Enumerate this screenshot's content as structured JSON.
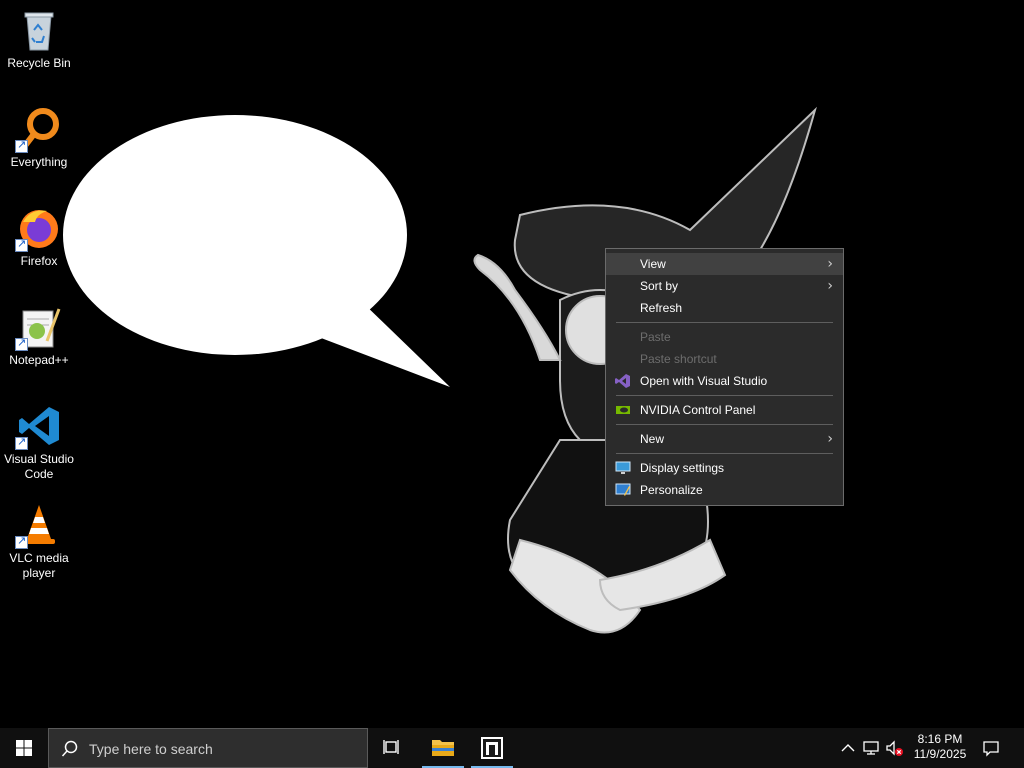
{
  "desktop": {
    "icons": [
      {
        "label": "Recycle Bin",
        "icon": "recycle-bin-icon",
        "shortcut": false
      },
      {
        "label": "Everything",
        "icon": "everything-search-icon",
        "shortcut": true
      },
      {
        "label": "Firefox",
        "icon": "firefox-icon",
        "shortcut": true
      },
      {
        "label": "Notepad++",
        "icon": "notepad-plus-plus-icon",
        "shortcut": true
      },
      {
        "label": "Visual Studio Code",
        "icon": "vscode-icon",
        "shortcut": true
      },
      {
        "label": "VLC media player",
        "icon": "vlc-icon",
        "shortcut": true
      }
    ]
  },
  "context_menu": {
    "items": [
      {
        "label": "View",
        "submenu": true,
        "enabled": true
      },
      {
        "label": "Sort by",
        "submenu": true,
        "enabled": true
      },
      {
        "label": "Refresh",
        "submenu": false,
        "enabled": true
      },
      {
        "label": "Paste",
        "submenu": false,
        "enabled": false
      },
      {
        "label": "Paste shortcut",
        "submenu": false,
        "enabled": false
      },
      {
        "label": "Open with Visual Studio",
        "icon": "visual-studio-icon",
        "enabled": true
      },
      {
        "label": "NVIDIA Control Panel",
        "icon": "nvidia-icon",
        "enabled": true
      },
      {
        "label": "New",
        "submenu": true,
        "enabled": true
      },
      {
        "label": "Display settings",
        "icon": "display-settings-icon",
        "enabled": true
      },
      {
        "label": "Personalize",
        "icon": "personalize-icon",
        "enabled": true
      }
    ]
  },
  "taskbar": {
    "search_placeholder": "Type here to search",
    "time": "8:16 PM",
    "date": "11/9/2025"
  },
  "colors": {
    "menu_bg": "#2b2b2b",
    "menu_hover": "#414141",
    "taskbar_bg": "#101010",
    "accent": "#76b9ed"
  }
}
